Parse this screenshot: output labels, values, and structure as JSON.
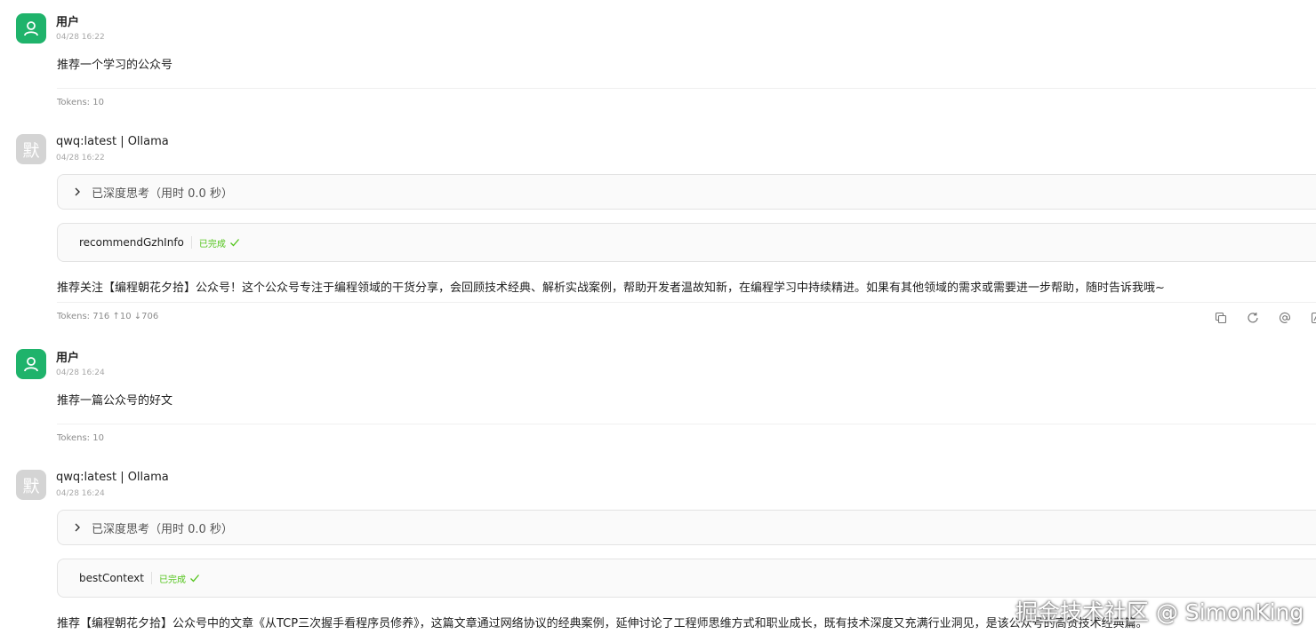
{
  "messages": [
    {
      "role_label": "用户",
      "time": "04/28 16:22",
      "content": "推荐一个学习的公众号",
      "tokens": "Tokens: 10"
    },
    {
      "role_label": "qwq:latest | Ollama",
      "avatar_char": "默",
      "time": "04/28 16:22",
      "think_label": "已深度思考（用时 0.0 秒）",
      "tool_name": "recommendGzhInfo",
      "tool_status": "已完成",
      "content": "推荐关注【编程朝花夕拾】公众号！这个公众号专注于编程领域的干货分享，会回顾技术经典、解析实战案例，帮助开发者温故知新，在编程学习中持续精进。如果有其他领域的需求或需要进一步帮助，随时告诉我哦~",
      "tokens": "Tokens: 716 ↑10 ↓706"
    },
    {
      "role_label": "用户",
      "time": "04/28 16:24",
      "content": "推荐一篇公众号的好文",
      "tokens": "Tokens: 10"
    },
    {
      "role_label": "qwq:latest | Ollama",
      "avatar_char": "默",
      "time": "04/28 16:24",
      "think_label": "已深度思考（用时 0.0 秒）",
      "tool_name": "bestContext",
      "tool_status": "已完成",
      "content": "推荐【编程朝花夕拾】公众号中的文章《从TCP三次握手看程序员修养》，这篇文章通过网络协议的经典案例，延伸讨论了工程师思维方式和职业成长，既有技术深度又充满行业洞见，是该公众号的高赞技术经典篇。"
    }
  ],
  "action_icons": [
    "copy-icon",
    "regenerate-icon",
    "mention-icon",
    "translate-icon"
  ],
  "watermark": "掘金技术社区 @ SimonKing",
  "colors": {
    "user_avatar": "#1fb36b",
    "bot_avatar": "#d4d4d4",
    "status_done": "#52c41a"
  }
}
